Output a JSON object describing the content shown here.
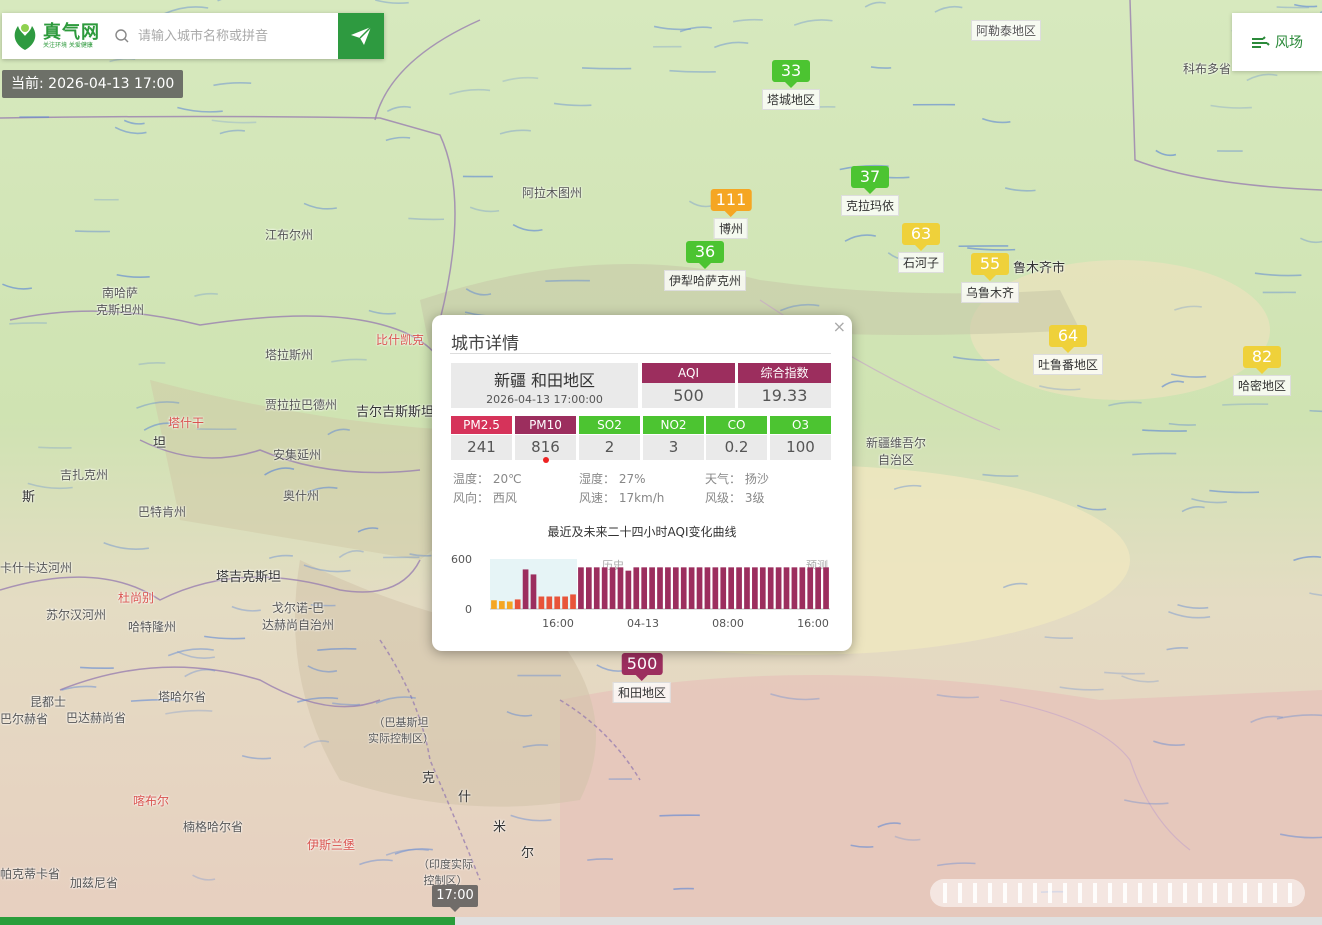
{
  "header": {
    "logo_title": "真气网",
    "logo_sub": "关注环境 关爱健康",
    "search_placeholder": "请输入城市名称或拼音",
    "current_time": "当前: 2026-04-13 17:00",
    "wind_label": "风场"
  },
  "colors": {
    "good": "#4cc431",
    "moderate": "#efd13a",
    "unhealthy_sensitive": "#f5a623",
    "severe": "#9c2e5e",
    "brand": "#2e9a40"
  },
  "markers": [
    {
      "value": "33",
      "name": "塔城地区",
      "color": "good"
    },
    {
      "value": "37",
      "name": "克拉玛依",
      "color": "good"
    },
    {
      "value": "111",
      "name": "博州",
      "color": "unhealthy_sensitive"
    },
    {
      "value": "36",
      "name": "伊犁哈萨克州",
      "color": "good"
    },
    {
      "value": "63",
      "name": "石河子",
      "color": "moderate"
    },
    {
      "value": "55",
      "name": "乌鲁木齐",
      "color": "moderate"
    },
    {
      "value": "64",
      "name": "吐鲁番地区",
      "color": "moderate"
    },
    {
      "value": "82",
      "name": "哈密地区",
      "color": "moderate"
    },
    {
      "value": "500",
      "name": "和田地区",
      "color": "severe"
    }
  ],
  "places": {
    "altay": "阿勒泰地区",
    "alatau": "阿拉木图州",
    "jiangbul": "江布尔州",
    "south_kaz": "南哈萨\n克斯坦州",
    "talas": "塔拉斯州",
    "bishkek": "比什凯克",
    "jalal": "贾拉拉巴德州",
    "kyrgyz": "吉尔吉斯斯坦",
    "tashkent": "塔什干",
    "tan": "坦",
    "jizzakh": "吉扎克州",
    "andijan": "安集延州",
    "osh": "奥什州",
    "si": "斯",
    "batken": "巴特肯州",
    "kashkadarya": "卡什卡达河州",
    "tajik": "塔吉克斯坦",
    "dushanbe": "杜尚别",
    "surxondaryo": "苏尔汉河州",
    "khatlon": "哈特隆州",
    "gorno": "戈尔诺-巴\n达赫尚自治州",
    "takhar": "塔哈尔省",
    "kunduz": "昆都士",
    "badakhshan": "巴达赫尚省",
    "balkh": "巴尔赫省",
    "kabul": "喀布尔",
    "nangarhar": "楠格哈尔省",
    "islamabad": "伊斯兰堡",
    "paktika": "帕克蒂卡省",
    "khost": "加兹尼省",
    "pak_control": "（巴基斯坦\n实际控制区）",
    "ind_control": "（印度实际\n控制区）",
    "ke": "克",
    "shi": "什",
    "mi": "米",
    "er": "尔",
    "xj": "新疆维吾尔\n自治区",
    "kobdo": "科布多省",
    "urumqi_city": "鲁木齐市"
  },
  "popup": {
    "title": "城市详情",
    "close": "×",
    "city": "新疆 和田地区",
    "time": "2026-04-13 17:00:00",
    "aqi_label": "AQI",
    "aqi_value": "500",
    "composite_label": "综合指数",
    "composite_value": "19.33",
    "pollutants": [
      {
        "name": "PM2.5",
        "value": "241",
        "color": "#d6335a"
      },
      {
        "name": "PM10",
        "value": "816",
        "color": "#9c2e5e"
      },
      {
        "name": "SO2",
        "value": "2",
        "color": "#4cc431"
      },
      {
        "name": "NO2",
        "value": "3",
        "color": "#4cc431"
      },
      {
        "name": "CO",
        "value": "0.2",
        "color": "#4cc431"
      },
      {
        "name": "O3",
        "value": "100",
        "color": "#4cc431"
      }
    ],
    "weather": {
      "temp": "温度： 20℃",
      "humidity": "湿度： 27%",
      "weather": "天气： 扬沙",
      "wind_dir": "风向： 西风",
      "wind_speed": "风速： 17km/h",
      "wind_level": "风级： 3级"
    },
    "chart_title": "最近及未来二十四小时AQI变化曲线"
  },
  "chart_data": {
    "type": "bar",
    "title": "最近及未来二十四小时AQI变化曲线",
    "ylim": [
      0,
      600
    ],
    "yticks": [
      "600",
      "0"
    ],
    "xticks": [
      "16:00",
      "04-13",
      "08:00",
      "16:00"
    ],
    "region_labels": {
      "history": "历史",
      "forecast": "预测"
    },
    "history_values": [
      105,
      95,
      90,
      115,
      475,
      415,
      150,
      150,
      150,
      150,
      175
    ],
    "forecast_values": [
      500,
      500,
      500,
      500,
      500,
      500,
      460,
      500,
      500,
      500,
      500,
      500,
      500,
      500,
      500,
      500,
      500,
      500,
      500,
      500,
      500,
      500,
      500,
      500,
      500,
      500,
      500,
      500,
      500,
      500,
      500,
      500
    ],
    "bar_colors_history": [
      "#f5a623",
      "#f5a623",
      "#f5a623",
      "#e8543a",
      "#9c2e5e",
      "#9c2e5e",
      "#e8543a",
      "#e8543a",
      "#e8543a",
      "#e8543a",
      "#e8543a"
    ],
    "forecast_color": "#9c2e5e"
  },
  "timeline": {
    "label": "17:00",
    "progress": 0.344
  }
}
